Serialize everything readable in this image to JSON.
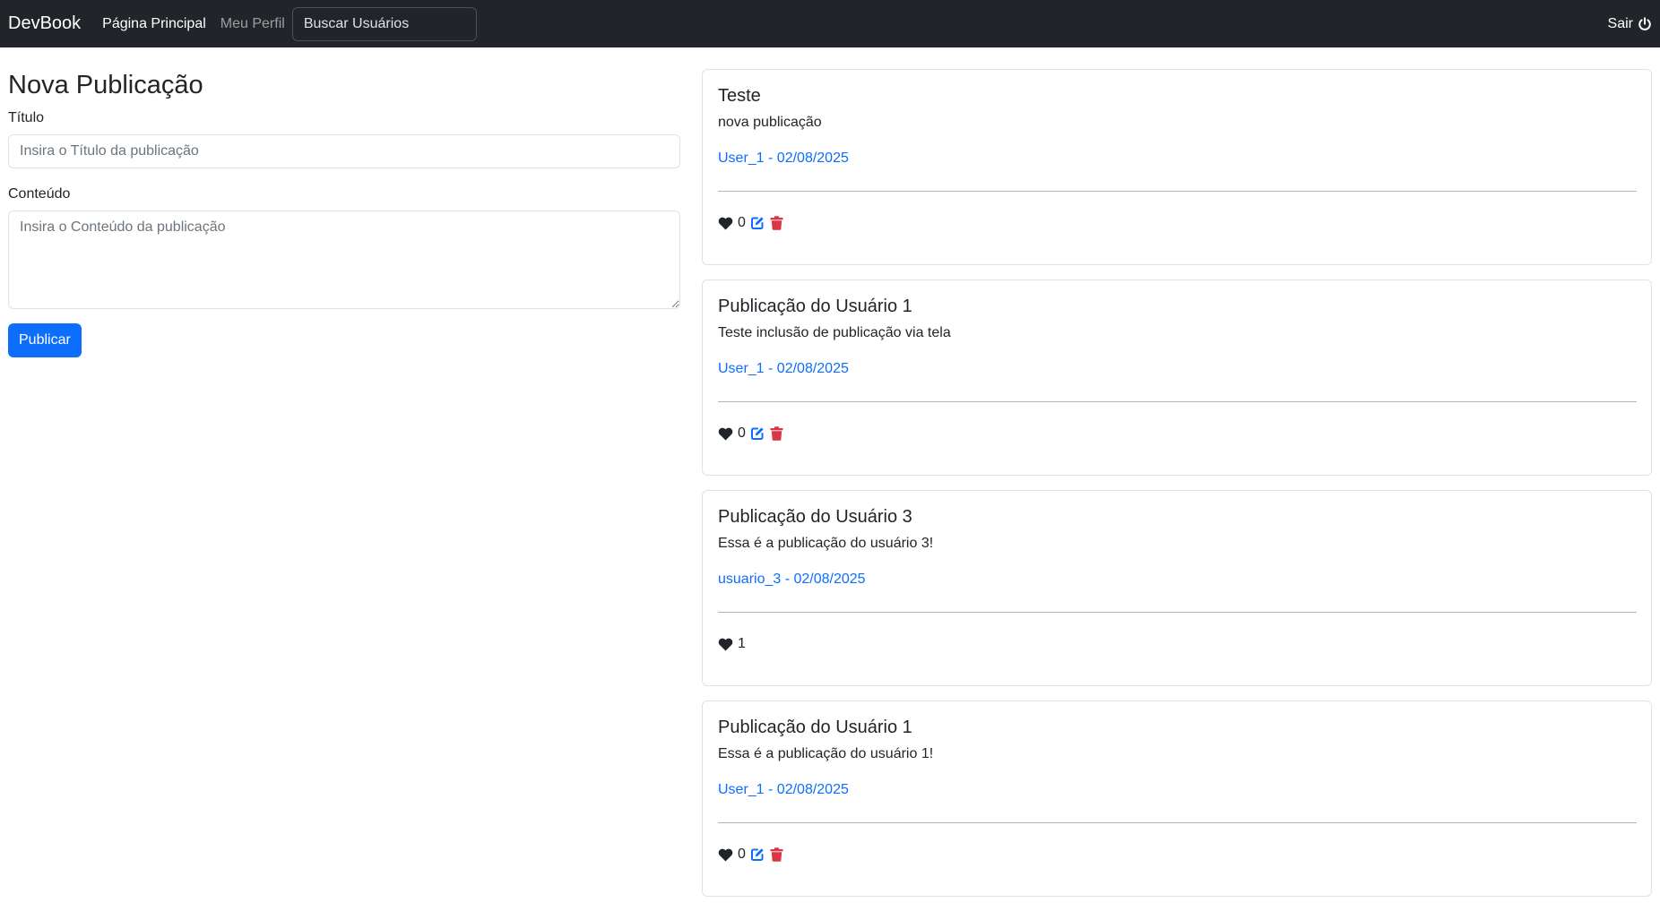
{
  "navbar": {
    "brand": "DevBook",
    "links": [
      {
        "label": "Página Principal",
        "active": true
      },
      {
        "label": "Meu Perfil",
        "active": false
      }
    ],
    "search_placeholder": "Buscar Usuários",
    "logout_label": "Sair",
    "logout_icon": "power-icon"
  },
  "form": {
    "heading": "Nova Publicação",
    "title_label": "Título",
    "title_placeholder": "Insira o Título da publicação",
    "title_value": "",
    "content_label": "Conteúdo",
    "content_placeholder": "Insira o Conteúdo da publicação",
    "content_value": "",
    "submit_label": "Publicar"
  },
  "colors": {
    "navbar_bg": "#212529",
    "primary": "#0d6efd",
    "danger": "#dc3545",
    "text": "#212529"
  },
  "publications": [
    {
      "title": "Teste",
      "content": "nova publicação",
      "meta": "User_1 - 02/08/2025",
      "likes": "0",
      "can_edit": true
    },
    {
      "title": "Publicação do Usuário 1",
      "content": "Teste inclusão de publicação via tela",
      "meta": "User_1 - 02/08/2025",
      "likes": "0",
      "can_edit": true
    },
    {
      "title": "Publicação do Usuário 3",
      "content": "Essa é a publicação do usuário 3!",
      "meta": "usuario_3 - 02/08/2025",
      "likes": "1",
      "can_edit": false
    },
    {
      "title": "Publicação do Usuário 1",
      "content": "Essa é a publicação do usuário 1!",
      "meta": "User_1 - 02/08/2025",
      "likes": "0",
      "can_edit": true
    }
  ]
}
